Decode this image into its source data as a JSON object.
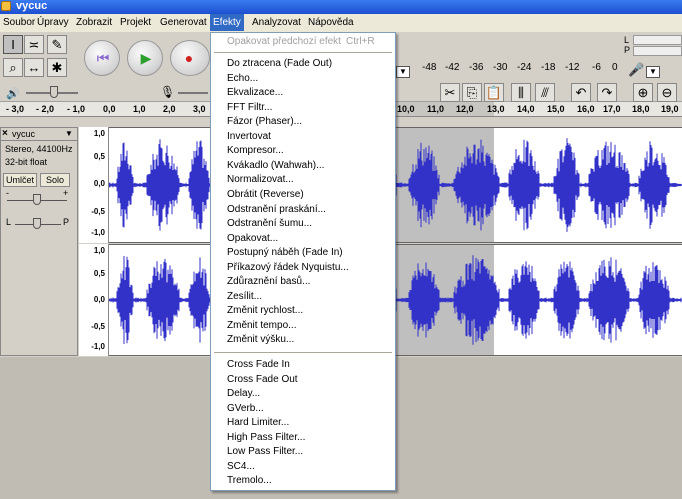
{
  "window": {
    "title": "vycuc"
  },
  "menubar": {
    "items": [
      {
        "key": "file",
        "label": "Soubor"
      },
      {
        "key": "edit",
        "label": "Úpravy"
      },
      {
        "key": "view",
        "label": "Zobrazit"
      },
      {
        "key": "project",
        "label": "Projekt"
      },
      {
        "key": "generate",
        "label": "Generovat"
      },
      {
        "key": "effects",
        "label": "Efekty"
      },
      {
        "key": "analyze",
        "label": "Analyzovat"
      },
      {
        "key": "help",
        "label": "Nápověda"
      }
    ]
  },
  "meters": {
    "scale": [
      "-48",
      "-42",
      "-36",
      "-30",
      "-24",
      "-18",
      "-12",
      "-6",
      "0"
    ],
    "left_letter": "L",
    "right_letter": "R",
    "playback_letter": "P"
  },
  "ruler": {
    "ticks": [
      "- 3,0",
      "- 2,0",
      "- 1,0",
      "0,0",
      "1,0",
      "2,0",
      "3,0",
      "10,0",
      "11,0",
      "12,0",
      "13,0",
      "14,0",
      "15,0",
      "16,0",
      "17,0",
      "18,0",
      "19,0"
    ]
  },
  "track": {
    "name": "vycuc",
    "format": "Stereo, 44100Hz",
    "bitdepth": "32-bit float",
    "mute_label": "Umlčet",
    "solo_label": "Solo",
    "gain_minus": "-",
    "gain_plus": "+",
    "pan_left": "L",
    "pan_right": "P",
    "yaxis": [
      "1,0",
      "0,5",
      "0,0",
      "-0,5",
      "-1,0"
    ]
  },
  "effects_menu": {
    "repeat": {
      "label": "Opakovat předchozí efekt",
      "shortcut": "Ctrl+R"
    },
    "builtin": [
      "Do ztracena (Fade Out)",
      "Echo...",
      "Ekvalizace...",
      "FFT Filtr...",
      "Fázor (Phaser)...",
      "Invertovat",
      "Kompresor...",
      "Kvákadlo (Wahwah)...",
      "Normalizovat...",
      "Obrátit (Reverse)",
      "Odstranění praskání...",
      "Odstranění šumu...",
      "Opakovat...",
      "Postupný náběh (Fade In)",
      "Příkazový řádek Nyquistu...",
      "Zdůraznění basů...",
      "Zesílit...",
      "Změnit rychlost...",
      "Změnit tempo...",
      "Změnit výšku..."
    ],
    "plugins": [
      "Cross Fade In",
      "Cross Fade Out",
      "Delay...",
      "GVerb...",
      "Hard Limiter...",
      "High Pass Filter...",
      "Low Pass Filter...",
      "SC4...",
      "Tremolo..."
    ]
  },
  "colors": {
    "waveform": "#3232c8",
    "menu_highlight": "#316ac5",
    "selection": "#bfbfbf"
  }
}
